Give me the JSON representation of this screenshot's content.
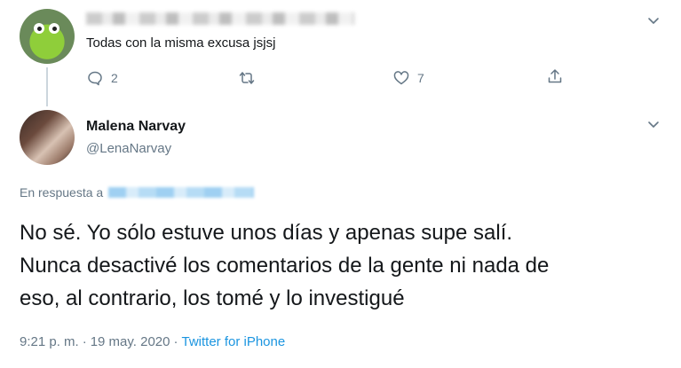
{
  "parent_tweet": {
    "author_name_obscured": true,
    "text": "Todas con la misma excusa jsjsj",
    "reply_count": "2",
    "retweet_count": "",
    "like_count": "7"
  },
  "reply_tweet": {
    "display_name": "Malena Narvay",
    "handle": "@LenaNarvay",
    "replying_to_label": "En respuesta a",
    "text_lines": [
      "No sé. Yo sólo estuve unos días y apenas supe salí.",
      "Nunca desactivé los comentarios de la gente ni nada de",
      "eso, al contrario, los tomé y lo investigué"
    ],
    "time": "9:21 p. m.",
    "separator": "·",
    "date": "19 may. 2020",
    "source": "Twitter for iPhone"
  },
  "icons": {
    "parent_menu": "chevron-down-icon",
    "reply": "reply-icon",
    "retweet": "retweet-icon",
    "like": "heart-icon",
    "share": "share-icon",
    "reply_menu": "chevron-down-icon"
  },
  "colors": {
    "text": "#14171a",
    "secondary": "#657786",
    "link": "#1b95e0",
    "thread_line": "#ccd6dd"
  }
}
